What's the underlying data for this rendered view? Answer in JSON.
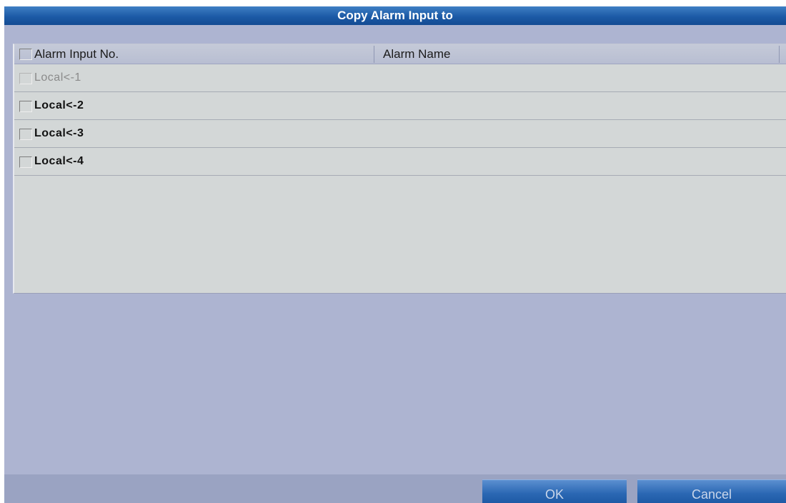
{
  "dialog": {
    "title": "Copy Alarm Input to"
  },
  "table": {
    "columns": [
      "Alarm Input No.",
      "Alarm Name"
    ],
    "rows": [
      {
        "alarm_input_no": "Local<-1",
        "alarm_name": "",
        "enabled": false,
        "checked": false
      },
      {
        "alarm_input_no": "Local<-2",
        "alarm_name": "",
        "enabled": true,
        "checked": false
      },
      {
        "alarm_input_no": "Local<-3",
        "alarm_name": "",
        "enabled": true,
        "checked": false
      },
      {
        "alarm_input_no": "Local<-4",
        "alarm_name": "",
        "enabled": true,
        "checked": false
      }
    ]
  },
  "buttons": {
    "ok_label": "OK",
    "cancel_label": "Cancel"
  },
  "colors": {
    "title_bar": "#1c5aa6",
    "dialog_background": "#adb4d1",
    "table_background": "#d3d7d7",
    "button": "#2a67b3"
  }
}
